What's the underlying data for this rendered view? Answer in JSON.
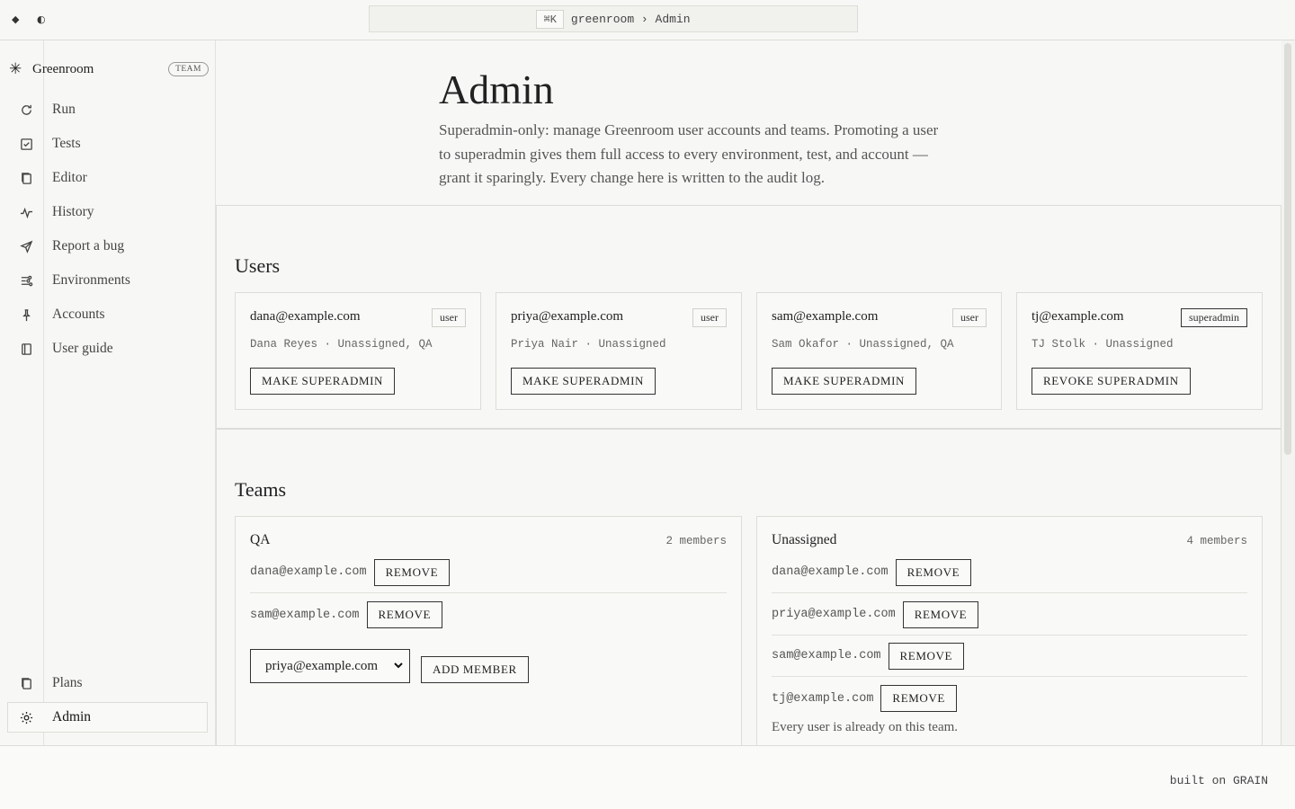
{
  "topbar": {
    "window_controls": "◆ ◐",
    "shortcut": "⌘K",
    "breadcrumb": "greenroom › Admin"
  },
  "sidebar": {
    "brand": {
      "mark": "✳",
      "name": "Greenroom",
      "badge": "TEAM"
    },
    "items": [
      {
        "label": "Run",
        "icon": "refresh-icon"
      },
      {
        "label": "Tests",
        "icon": "checkbox-icon"
      },
      {
        "label": "Editor",
        "icon": "copy-icon"
      },
      {
        "label": "History",
        "icon": "activity-icon"
      },
      {
        "label": "Report a bug",
        "icon": "send-icon"
      },
      {
        "label": "Environments",
        "icon": "sliders-icon"
      },
      {
        "label": "Accounts",
        "icon": "pin-icon"
      },
      {
        "label": "User guide",
        "icon": "book-icon"
      }
    ],
    "bottom_items": [
      {
        "label": "Plans",
        "icon": "copy-icon"
      },
      {
        "label": "Admin",
        "icon": "sun-icon",
        "active": true
      }
    ]
  },
  "page": {
    "title": "Admin",
    "description": "Superadmin-only: manage Greenroom user accounts and teams. Promoting a user to superadmin gives them full access to every environment, test, and account — grant it sparingly. Every change here is written to the audit log."
  },
  "users": {
    "heading": "Users",
    "cards": [
      {
        "email": "dana@example.com",
        "role": "user",
        "meta": "Dana Reyes · Unassigned, QA",
        "action": "MAKE SUPERADMIN"
      },
      {
        "email": "priya@example.com",
        "role": "user",
        "meta": "Priya Nair · Unassigned",
        "action": "MAKE SUPERADMIN"
      },
      {
        "email": "sam@example.com",
        "role": "user",
        "meta": "Sam Okafor · Unassigned, QA",
        "action": "MAKE SUPERADMIN"
      },
      {
        "email": "tj@example.com",
        "role": "superadmin",
        "meta": "TJ Stolk · Unassigned",
        "action": "REVOKE SUPERADMIN"
      }
    ]
  },
  "teams": {
    "heading": "Teams",
    "cards": [
      {
        "name": "QA",
        "count": "2 members",
        "members": [
          "dana@example.com",
          "sam@example.com"
        ],
        "remove_label": "REMOVE",
        "select_value": "priya@example.com",
        "add_label": "ADD MEMBER"
      },
      {
        "name": "Unassigned",
        "count": "4 members",
        "members": [
          "dana@example.com",
          "priya@example.com",
          "sam@example.com",
          "tj@example.com"
        ],
        "remove_label": "REMOVE",
        "note": "Every user is already on this team."
      }
    ]
  },
  "footer": {
    "built": "built on GRAIN"
  }
}
